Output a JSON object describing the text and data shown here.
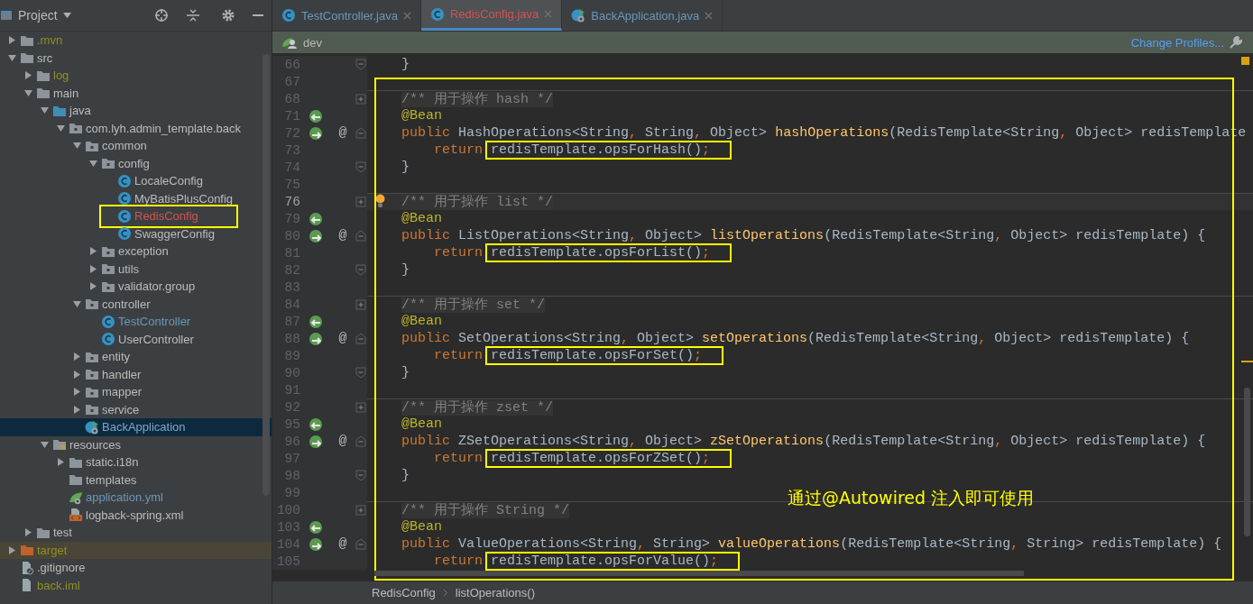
{
  "sidebar": {
    "title": "Project",
    "tree": [
      {
        "label": ".mvn",
        "kind": "folder",
        "color": "#8f8f22",
        "expanded": false,
        "selected": false
      },
      {
        "label": "src",
        "kind": "folder",
        "color": "#bbbbbb",
        "expanded": true,
        "selected": false,
        "children": [
          {
            "label": "log",
            "kind": "folder",
            "color": "#8f8f22",
            "expanded": false,
            "selected": false
          },
          {
            "label": "main",
            "kind": "folder",
            "color": "#bbbbbb",
            "expanded": true,
            "selected": false,
            "children": [
              {
                "label": "java",
                "kind": "source-root",
                "color": "#bbbbbb",
                "expanded": true,
                "selected": false,
                "children": [
                  {
                    "label": "com.lyh.admin_template.back",
                    "kind": "package",
                    "color": "#bbbbbb",
                    "expanded": true,
                    "selected": false,
                    "children": [
                      {
                        "label": "common",
                        "kind": "package",
                        "color": "#bbbbbb",
                        "expanded": true,
                        "selected": false,
                        "children": [
                          {
                            "label": "config",
                            "kind": "package",
                            "color": "#bbbbbb",
                            "expanded": true,
                            "selected": false,
                            "children": [
                              {
                                "label": "LocaleConfig",
                                "kind": "class",
                                "color": "#bbbbbb",
                                "selected": false
                              },
                              {
                                "label": "MyBatisPlusConfig",
                                "kind": "class",
                                "color": "#bbbbbb",
                                "selected": false
                              },
                              {
                                "label": "RedisConfig",
                                "kind": "class",
                                "color": "#d25252",
                                "selected": false,
                                "boxed": true
                              },
                              {
                                "label": "SwaggerConfig",
                                "kind": "class",
                                "color": "#bbbbbb",
                                "selected": false
                              }
                            ]
                          },
                          {
                            "label": "exception",
                            "kind": "package",
                            "color": "#bbbbbb",
                            "expanded": false,
                            "selected": false
                          },
                          {
                            "label": "utils",
                            "kind": "package",
                            "color": "#bbbbbb",
                            "expanded": false,
                            "selected": false
                          },
                          {
                            "label": "validator.group",
                            "kind": "package",
                            "color": "#bbbbbb",
                            "expanded": false,
                            "selected": false
                          }
                        ]
                      },
                      {
                        "label": "controller",
                        "kind": "package",
                        "color": "#bbbbbb",
                        "expanded": true,
                        "selected": false,
                        "children": [
                          {
                            "label": "TestController",
                            "kind": "class",
                            "color": "#6897bb",
                            "selected": false
                          },
                          {
                            "label": "UserController",
                            "kind": "class",
                            "color": "#bbbbbb",
                            "selected": false
                          }
                        ]
                      },
                      {
                        "label": "entity",
                        "kind": "package",
                        "color": "#bbbbbb",
                        "expanded": false,
                        "selected": false
                      },
                      {
                        "label": "handler",
                        "kind": "package",
                        "color": "#bbbbbb",
                        "expanded": false,
                        "selected": false
                      },
                      {
                        "label": "mapper",
                        "kind": "package",
                        "color": "#bbbbbb",
                        "expanded": false,
                        "selected": false
                      },
                      {
                        "label": "service",
                        "kind": "package",
                        "color": "#bbbbbb",
                        "expanded": false,
                        "selected": false
                      },
                      {
                        "label": "BackApplication",
                        "kind": "spring-class",
                        "color": "#7ea6cc",
                        "selected": true
                      }
                    ]
                  }
                ]
              },
              {
                "label": "resources",
                "kind": "resources-root",
                "color": "#bbbbbb",
                "expanded": true,
                "selected": false,
                "children": [
                  {
                    "label": "static.i18n",
                    "kind": "folder",
                    "color": "#bbbbbb",
                    "expanded": false,
                    "selected": false
                  },
                  {
                    "label": "templates",
                    "kind": "folder",
                    "color": "#bbbbbb",
                    "selected": false
                  },
                  {
                    "label": "application.yml",
                    "kind": "yml",
                    "color": "#6897bb",
                    "selected": false
                  },
                  {
                    "label": "logback-spring.xml",
                    "kind": "xml",
                    "color": "#bbbbbb",
                    "selected": false
                  }
                ]
              }
            ]
          },
          {
            "label": "test",
            "kind": "folder",
            "color": "#bbbbbb",
            "expanded": false,
            "selected": false
          }
        ]
      },
      {
        "label": "target",
        "kind": "excluded-folder",
        "color": "#8f8f22",
        "expanded": false,
        "selected": false
      },
      {
        "label": ".gitignore",
        "kind": "ignore-file",
        "color": "#bbbbbb",
        "selected": false
      },
      {
        "label": "back.iml",
        "kind": "module-file",
        "color": "#8f8f22",
        "selected": false
      }
    ]
  },
  "tabs": [
    {
      "label": "TestController.java",
      "kind": "class",
      "color": "#6897bb",
      "selected": false
    },
    {
      "label": "RedisConfig.java",
      "kind": "class",
      "color": "#d25252",
      "selected": true
    },
    {
      "label": "BackApplication.java",
      "kind": "spring-class",
      "color": "#6897bb",
      "selected": false
    }
  ],
  "profile_bar": {
    "profile": "dev",
    "action": "Change Profiles..."
  },
  "editor": {
    "lines": [
      {
        "number": "66",
        "kind": "closing",
        "tokens": [
          {
            "kind": "plain",
            "text": "}"
          }
        ]
      },
      {
        "number": "67",
        "kind": "blank"
      },
      {
        "number": "68",
        "kind": "doc",
        "tokens": [
          {
            "kind": "doc",
            "text": "/** 用于操作 hash */"
          }
        ]
      },
      {
        "number": "71",
        "kind": "bean",
        "tokens": [
          {
            "kind": "annotation",
            "text": "@Bean"
          }
        ]
      },
      {
        "number": "72",
        "kind": "signature",
        "marker": "@",
        "tokens": [
          {
            "kind": "keyword",
            "text": "public"
          },
          {
            "kind": "plain",
            "text": " HashOperations<String"
          },
          {
            "kind": "punct",
            "text": ","
          },
          {
            "kind": "plain",
            "text": " String"
          },
          {
            "kind": "punct",
            "text": ","
          },
          {
            "kind": "plain",
            "text": " Object> "
          },
          {
            "kind": "method",
            "text": "hashOperations"
          },
          {
            "kind": "plain",
            "text": "(RedisTemplate<String"
          },
          {
            "kind": "punct",
            "text": ","
          },
          {
            "kind": "plain",
            "text": " Object> redisTemplate"
          }
        ]
      },
      {
        "number": "73",
        "kind": "body",
        "tokens": [
          {
            "kind": "keyword",
            "text": "return"
          },
          {
            "kind": "call",
            "text": "redisTemplate.opsForHash()",
            "end": ";",
            "boxed": true
          }
        ]
      },
      {
        "number": "74",
        "kind": "closing",
        "tokens": [
          {
            "kind": "plain",
            "text": "}"
          }
        ]
      },
      {
        "number": "75",
        "kind": "blank"
      },
      {
        "number": "76",
        "kind": "doc",
        "current": true,
        "intention": true,
        "tokens": [
          {
            "kind": "doc",
            "text": "/** 用于操作 list */"
          }
        ]
      },
      {
        "number": "79",
        "kind": "bean",
        "tokens": [
          {
            "kind": "annotation",
            "text": "@Bean"
          }
        ]
      },
      {
        "number": "80",
        "kind": "signature",
        "marker": "@",
        "tokens": [
          {
            "kind": "keyword",
            "text": "public"
          },
          {
            "kind": "plain",
            "text": " ListOperations<String"
          },
          {
            "kind": "punct",
            "text": ","
          },
          {
            "kind": "plain",
            "text": " Object> "
          },
          {
            "kind": "method",
            "text": "listOperations"
          },
          {
            "kind": "plain",
            "text": "(RedisTemplate<String"
          },
          {
            "kind": "punct",
            "text": ","
          },
          {
            "kind": "plain",
            "text": " Object> redisTemplate) {"
          }
        ]
      },
      {
        "number": "81",
        "kind": "body",
        "tokens": [
          {
            "kind": "keyword",
            "text": "return"
          },
          {
            "kind": "call",
            "text": "redisTemplate.opsForList()",
            "end": ";",
            "boxed": true
          }
        ]
      },
      {
        "number": "82",
        "kind": "closing",
        "tokens": [
          {
            "kind": "plain",
            "text": "}"
          }
        ]
      },
      {
        "number": "83",
        "kind": "blank"
      },
      {
        "number": "84",
        "kind": "doc",
        "tokens": [
          {
            "kind": "doc",
            "text": "/** 用于操作 set */"
          }
        ]
      },
      {
        "number": "87",
        "kind": "bean",
        "tokens": [
          {
            "kind": "annotation",
            "text": "@Bean"
          }
        ]
      },
      {
        "number": "88",
        "kind": "signature",
        "marker": "@",
        "tokens": [
          {
            "kind": "keyword",
            "text": "public"
          },
          {
            "kind": "plain",
            "text": " SetOperations<String"
          },
          {
            "kind": "punct",
            "text": ","
          },
          {
            "kind": "plain",
            "text": " Object> "
          },
          {
            "kind": "method",
            "text": "setOperations"
          },
          {
            "kind": "plain",
            "text": "(RedisTemplate<String"
          },
          {
            "kind": "punct",
            "text": ","
          },
          {
            "kind": "plain",
            "text": " Object> redisTemplate) {"
          }
        ]
      },
      {
        "number": "89",
        "kind": "body",
        "tokens": [
          {
            "kind": "keyword",
            "text": "return"
          },
          {
            "kind": "call",
            "text": "redisTemplate.opsForSet()",
            "end": ";",
            "boxed": true
          }
        ]
      },
      {
        "number": "90",
        "kind": "closing",
        "tokens": [
          {
            "kind": "plain",
            "text": "}"
          }
        ]
      },
      {
        "number": "91",
        "kind": "blank"
      },
      {
        "number": "92",
        "kind": "doc",
        "tokens": [
          {
            "kind": "doc",
            "text": "/** 用于操作 zset */"
          }
        ]
      },
      {
        "number": "95",
        "kind": "bean",
        "tokens": [
          {
            "kind": "annotation",
            "text": "@Bean"
          }
        ]
      },
      {
        "number": "96",
        "kind": "signature",
        "marker": "@",
        "tokens": [
          {
            "kind": "keyword",
            "text": "public"
          },
          {
            "kind": "plain",
            "text": " ZSetOperations<String"
          },
          {
            "kind": "punct",
            "text": ","
          },
          {
            "kind": "plain",
            "text": " Object> "
          },
          {
            "kind": "method",
            "text": "zSetOperations"
          },
          {
            "kind": "plain",
            "text": "(RedisTemplate<String"
          },
          {
            "kind": "punct",
            "text": ","
          },
          {
            "kind": "plain",
            "text": " Object> redisTemplate) {"
          }
        ]
      },
      {
        "number": "97",
        "kind": "body",
        "tokens": [
          {
            "kind": "keyword",
            "text": "return"
          },
          {
            "kind": "call",
            "text": "redisTemplate.opsForZSet()",
            "end": ";",
            "boxed": true
          }
        ]
      },
      {
        "number": "98",
        "kind": "closing",
        "tokens": [
          {
            "kind": "plain",
            "text": "}"
          }
        ]
      },
      {
        "number": "99",
        "kind": "blank"
      },
      {
        "number": "100",
        "kind": "doc",
        "tokens": [
          {
            "kind": "doc",
            "text": "/** 用于操作 String */"
          }
        ]
      },
      {
        "number": "103",
        "kind": "bean",
        "tokens": [
          {
            "kind": "annotation",
            "text": "@Bean"
          }
        ]
      },
      {
        "number": "104",
        "kind": "signature",
        "marker": "@",
        "tokens": [
          {
            "kind": "keyword",
            "text": "public"
          },
          {
            "kind": "plain",
            "text": " ValueOperations<String"
          },
          {
            "kind": "punct",
            "text": ","
          },
          {
            "kind": "plain",
            "text": " String> "
          },
          {
            "kind": "method",
            "text": "valueOperations"
          },
          {
            "kind": "plain",
            "text": "(RedisTemplate<String"
          },
          {
            "kind": "punct",
            "text": ","
          },
          {
            "kind": "plain",
            "text": " String> redisTemplate) {"
          }
        ]
      },
      {
        "number": "105",
        "kind": "body",
        "tokens": [
          {
            "kind": "keyword",
            "text": "return"
          },
          {
            "kind": "call",
            "text": "redisTemplate.opsForValue()",
            "end": ";",
            "boxed": true
          }
        ]
      }
    ],
    "callout": "通过@Autowired 注入即可使用"
  },
  "breadcrumbs": [
    "RedisConfig",
    "listOperations()"
  ]
}
